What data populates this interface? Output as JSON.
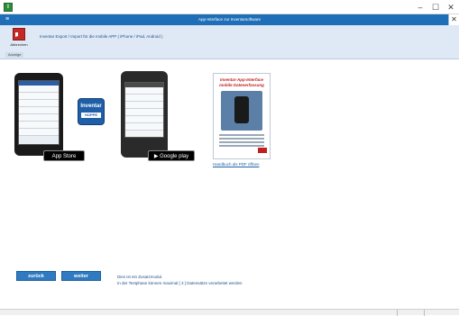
{
  "window": {
    "app_icon_letter": "I",
    "minimize_glyph": "–",
    "maximize_glyph": "☐",
    "close_glyph": "✕"
  },
  "inner_window": {
    "title": "App-Interface zur Inventarsoftware",
    "close_glyph": "✕"
  },
  "ribbon": {
    "button_label": "Abbrechen",
    "group_label": "Anzeige",
    "info_text": "Inventar Export / Import für die mobile APP ( iPhone / iPad, Android )"
  },
  "badges": {
    "app_store": " App Store",
    "google_play": "▶ Google play"
  },
  "logo": {
    "text": "Inventar",
    "subtext": "HOPPE"
  },
  "brochure": {
    "title_line1": "Inventar-App-Interface",
    "title_line2": "mobile Datenerfassung",
    "link": "Handbuch als PDF öffnen"
  },
  "navigation": {
    "back_label": "zurück",
    "next_label": "weiter"
  },
  "notice": {
    "line1": "Dies ist ein Zusatzmodul.",
    "line2": "In der Testphase können maximal [ 3 ] Datensätze verarbeitet werden"
  },
  "colors": {
    "title_blue": "#1f6fb8",
    "ribbon_bg": "#dfe9f5",
    "button_blue": "#2f7ac0",
    "accent_red": "#c01f1f"
  }
}
